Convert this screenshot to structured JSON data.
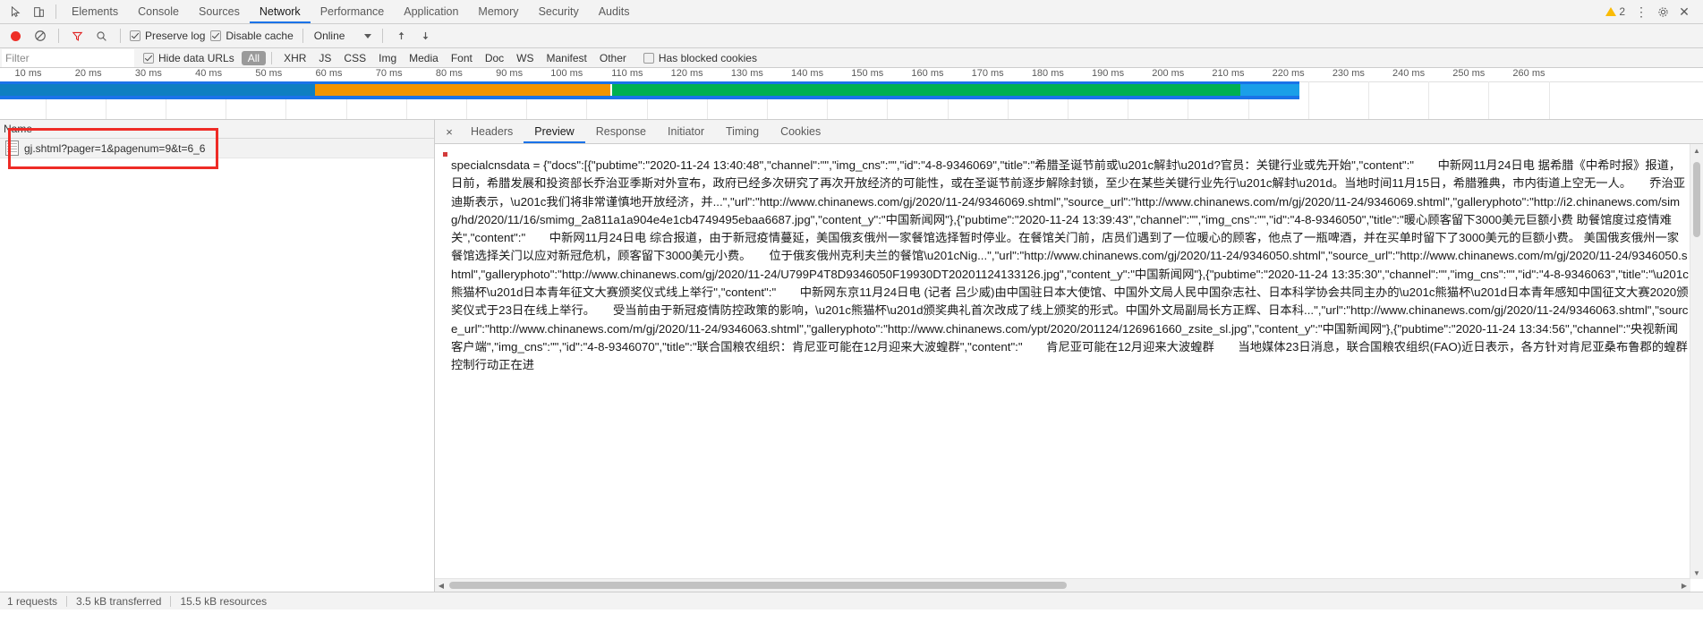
{
  "tabbar": {
    "inspect_icon": "cursor-inspect-icon",
    "device_icon": "device-toolbar-icon",
    "tabs": [
      {
        "label": "Elements",
        "active": false
      },
      {
        "label": "Console",
        "active": false
      },
      {
        "label": "Sources",
        "active": false
      },
      {
        "label": "Network",
        "active": true
      },
      {
        "label": "Performance",
        "active": false
      },
      {
        "label": "Application",
        "active": false
      },
      {
        "label": "Memory",
        "active": false
      },
      {
        "label": "Security",
        "active": false
      },
      {
        "label": "Audits",
        "active": false
      }
    ],
    "warning_count": "2",
    "more_icon": "kebab-menu-icon",
    "settings_icon": "gear-icon",
    "close_icon": "close-icon"
  },
  "toolbar": {
    "record_icon": "record-stop-icon",
    "clear_icon": "clear-no-entry-icon",
    "filter_icon": "funnel-filter-icon",
    "search_icon": "search-icon",
    "preserve_log_label": "Preserve log",
    "preserve_log_checked": true,
    "disable_cache_label": "Disable cache",
    "disable_cache_checked": true,
    "throttle_value": "Online",
    "import_icon": "import-har-icon",
    "export_icon": "export-har-icon"
  },
  "filterbar": {
    "filter_placeholder": "Filter",
    "filter_value": "",
    "hide_data_urls_label": "Hide data URLs",
    "hide_data_urls_checked": true,
    "types": [
      {
        "label": "All",
        "selected": true
      },
      {
        "label": "XHR",
        "selected": false
      },
      {
        "label": "JS",
        "selected": false
      },
      {
        "label": "CSS",
        "selected": false
      },
      {
        "label": "Img",
        "selected": false
      },
      {
        "label": "Media",
        "selected": false
      },
      {
        "label": "Font",
        "selected": false
      },
      {
        "label": "Doc",
        "selected": false
      },
      {
        "label": "WS",
        "selected": false
      },
      {
        "label": "Manifest",
        "selected": false
      },
      {
        "label": "Other",
        "selected": false
      }
    ],
    "has_blocked_cookies_label": "Has blocked cookies",
    "has_blocked_cookies_checked": false
  },
  "overview": {
    "ticks": [
      "10 ms",
      "20 ms",
      "30 ms",
      "40 ms",
      "50 ms",
      "60 ms",
      "70 ms",
      "80 ms",
      "90 ms",
      "100 ms",
      "110 ms",
      "120 ms",
      "130 ms",
      "140 ms",
      "150 ms",
      "160 ms",
      "170 ms",
      "180 ms",
      "190 ms",
      "200 ms",
      "210 ms",
      "220 ms",
      "230 ms",
      "240 ms",
      "250 ms",
      "260 ms"
    ],
    "colors": {
      "blue": "#0e7fc1",
      "orange": "#f29500",
      "green": "#00b050",
      "light_blue": "#1a9fe8",
      "bar_underline": "#1565d8"
    }
  },
  "requests": {
    "column_name": "Name",
    "rows": [
      {
        "name": "gj.shtml?pager=1&pagenum=9&t=6_6",
        "icon": "document-icon",
        "selected": true
      }
    ]
  },
  "detail": {
    "close_label": "×",
    "tabs": [
      {
        "label": "Headers",
        "active": false
      },
      {
        "label": "Preview",
        "active": true
      },
      {
        "label": "Response",
        "active": false
      },
      {
        "label": "Initiator",
        "active": false
      },
      {
        "label": "Timing",
        "active": false
      },
      {
        "label": "Cookies",
        "active": false
      }
    ],
    "preview_text": "specialcnsdata = {\"docs\":[{\"pubtime\":\"2020-11-24 13:40:48\",\"channel\":\"\",\"img_cns\":\"\",\"id\":\"4-8-9346069\",\"title\":\"希腊圣诞节前或\\u201c解封\\u201d?官员：关键行业或先开始\",\"content\":\"　　中新网11月24日电 据希腊《中希时报》报道，日前，希腊发展和投资部长乔治亚季斯对外宣布，政府已经多次研究了再次开放经济的可能性，或在圣诞节前逐步解除封锁，至少在某些关键行业先行\\u201c解封\\u201d。当地时间11月15日，希腊雅典，市内街道上空无一人。　　乔治亚迪斯表示，\\u201c我们将非常谨慎地开放经济，并...\",\"url\":\"http://www.chinanews.com/gj/2020/11-24/9346069.shtml\",\"source_url\":\"http://www.chinanews.com/m/gj/2020/11-24/9346069.shtml\",\"galleryphoto\":\"http://i2.chinanews.com/simg/hd/2020/11/16/smimg_2a811a1a904e4e1cb4749495ebaa6687.jpg\",\"content_y\":\"中国新闻网\"},{\"pubtime\":\"2020-11-24 13:39:43\",\"channel\":\"\",\"img_cns\":\"\",\"id\":\"4-8-9346050\",\"title\":\"暖心顾客留下3000美元巨额小费 助餐馆度过疫情难关\",\"content\":\"　　中新网11月24日电 综合报道，由于新冠疫情蔓延，美国俄亥俄州一家餐馆选择暂时停业。在餐馆关门前，店员们遇到了一位暖心的顾客，他点了一瓶啤酒，并在买单时留下了3000美元的巨额小费。 美国俄亥俄州一家餐馆选择关门以应对新冠危机，顾客留下3000美元小费。　　位于俄亥俄州克利夫兰的餐馆\\u201cNig...\",\"url\":\"http://www.chinanews.com/gj/2020/11-24/9346050.shtml\",\"source_url\":\"http://www.chinanews.com/m/gj/2020/11-24/9346050.shtml\",\"galleryphoto\":\"http://www.chinanews.com/gj/2020/11-24/U799P4T8D9346050F19930DT20201124133126.jpg\",\"content_y\":\"中国新闻网\"},{\"pubtime\":\"2020-11-24 13:35:30\",\"channel\":\"\",\"img_cns\":\"\",\"id\":\"4-8-9346063\",\"title\":\"\\u201c熊猫杯\\u201d日本青年征文大赛颁奖仪式线上举行\",\"content\":\"　　中新网东京11月24日电 (记者 吕少威)由中国驻日本大使馆、中国外文局人民中国杂志社、日本科学协会共同主办的\\u201c熊猫杯\\u201d日本青年感知中国征文大赛2020颁奖仪式于23日在线上举行。　　受当前由于新冠疫情防控政策的影响，\\u201c熊猫杯\\u201d颁奖典礼首次改成了线上颁奖的形式。中国外文局副局长方正辉、日本科...\",\"url\":\"http://www.chinanews.com/gj/2020/11-24/9346063.shtml\",\"source_url\":\"http://www.chinanews.com/m/gj/2020/11-24/9346063.shtml\",\"galleryphoto\":\"http://www.chinanews.com/ypt/2020/201124/126961660_zsite_sl.jpg\",\"content_y\":\"中国新闻网\"},{\"pubtime\":\"2020-11-24 13:34:56\",\"channel\":\"央视新闻客户端\",\"img_cns\":\"\",\"id\":\"4-8-9346070\",\"title\":\"联合国粮农组织：肯尼亚可能在12月迎来大波蝗群\",\"content\":\"　　肯尼亚可能在12月迎来大波蝗群　　当地媒体23日消息，联合国粮农组织(FAO)近日表示，各方针对肯尼亚桑布鲁郡的蝗群控制行动正在进"
  },
  "statusbar": {
    "requests": "1 requests",
    "transferred": "3.5 kB transferred",
    "resources": "15.5 kB resources"
  }
}
